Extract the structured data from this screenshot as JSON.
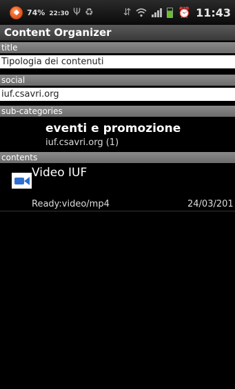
{
  "status_bar": {
    "battery_percent": "74%",
    "small_time": "22:30",
    "clock": "11:43"
  },
  "title_bar": {
    "title": "Content Organizer"
  },
  "sections": {
    "title": {
      "header": "title",
      "value": "Tipologia dei contenuti"
    },
    "social": {
      "header": "social",
      "value": "iuf.csavri.org"
    },
    "subcategories": {
      "header": "sub-categories",
      "items": [
        {
          "name": "eventi e promozione",
          "detail": "iuf.csavri.org (1)"
        }
      ]
    },
    "contents": {
      "header": "contents",
      "items": [
        {
          "title": "Video IUF",
          "status": "Ready:video/mp4",
          "date": "24/03/201"
        }
      ]
    }
  },
  "colors": {
    "background": "#000000",
    "section_header": "#7a7a7a",
    "title_bar": "#4a4a4a",
    "video_icon": "#2f6fd0"
  }
}
